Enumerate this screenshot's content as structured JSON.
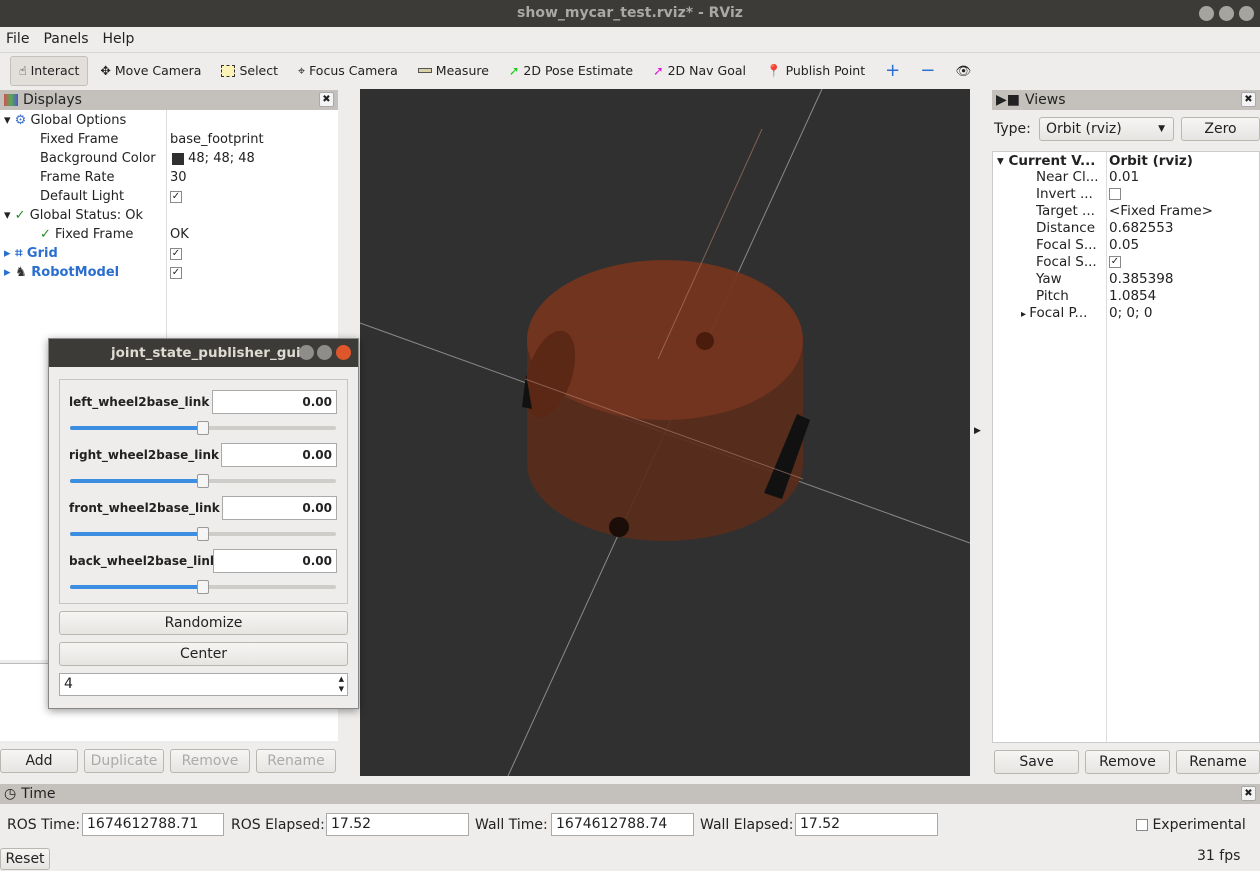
{
  "window": {
    "title": "show_mycar_test.rviz* - RViz"
  },
  "menu": [
    "File",
    "Panels",
    "Help"
  ],
  "toolbar": [
    {
      "label": "Interact",
      "icon": "hand-icon"
    },
    {
      "label": "Move Camera",
      "icon": "move-icon"
    },
    {
      "label": "Select",
      "icon": "select-icon"
    },
    {
      "label": "Focus Camera",
      "icon": "focus-icon"
    },
    {
      "label": "Measure",
      "icon": "ruler-icon"
    },
    {
      "label": "2D Pose Estimate",
      "icon": "green-arrow-icon"
    },
    {
      "label": "2D Nav Goal",
      "icon": "magenta-arrow-icon"
    },
    {
      "label": "Publish Point",
      "icon": "pin-icon"
    }
  ],
  "displays": {
    "title": "Displays",
    "global_options": "Global Options",
    "rows": [
      {
        "k": "Fixed Frame",
        "v": "base_footprint"
      },
      {
        "k": "Background Color",
        "v": "48; 48; 48"
      },
      {
        "k": "Frame Rate",
        "v": "30"
      },
      {
        "k": "Default Light",
        "v": "✓"
      }
    ],
    "global_status": "Global Status: Ok",
    "fixed_frame": "Fixed Frame",
    "fixed_frame_status": "OK",
    "grid": "Grid",
    "robot_model": "RobotModel",
    "buttons": [
      "Add",
      "Duplicate",
      "Remove",
      "Rename"
    ]
  },
  "jsp": {
    "title": "joint_state_publisher_gui",
    "joints": [
      {
        "name": "left_wheel2base_link",
        "value": "0.00"
      },
      {
        "name": "right_wheel2base_link",
        "value": "0.00"
      },
      {
        "name": "front_wheel2base_link",
        "value": "0.00"
      },
      {
        "name": "back_wheel2base_link",
        "value": "0.00"
      }
    ],
    "slider_fraction": 0.5,
    "randomize": "Randomize",
    "center": "Center",
    "spin": "4"
  },
  "views": {
    "title": "Views",
    "type_label": "Type:",
    "type_value": "Orbit (rviz)",
    "zero": "Zero",
    "current": "Current V...",
    "current_value": "Orbit (rviz)",
    "rows": [
      {
        "k": "Near Cl...",
        "v": "0.01"
      },
      {
        "k": "Invert ...",
        "v": ""
      },
      {
        "k": "Target ...",
        "v": "<Fixed Frame>"
      },
      {
        "k": "Distance",
        "v": "0.682553"
      },
      {
        "k": "Focal S...",
        "v": "0.05"
      },
      {
        "k": "Focal S...",
        "v": "✓"
      },
      {
        "k": "Yaw",
        "v": "0.385398"
      },
      {
        "k": "Pitch",
        "v": "1.0854"
      },
      {
        "k": "Focal P...",
        "v": "0; 0; 0"
      }
    ],
    "buttons": [
      "Save",
      "Remove",
      "Rename"
    ]
  },
  "time": {
    "title": "Time",
    "ros_time_label": "ROS Time:",
    "ros_time": "1674612788.71",
    "ros_elapsed_label": "ROS Elapsed:",
    "ros_elapsed": "17.52",
    "wall_time_label": "Wall Time:",
    "wall_time": "1674612788.74",
    "wall_elapsed_label": "Wall Elapsed:",
    "wall_elapsed": "17.52",
    "experimental": "Experimental",
    "reset": "Reset",
    "fps": "31 fps"
  },
  "colors": {
    "background": "#303030",
    "robot": "#7a3a22"
  }
}
